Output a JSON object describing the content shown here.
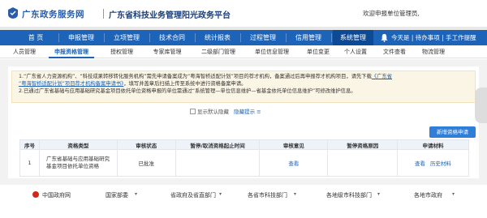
{
  "header": {
    "logo_text": "广东政务服务网",
    "system_title": "广东省科技业务管理阳光政务平台",
    "welcome": "欢迎申报单位管理员,"
  },
  "main_nav": {
    "items": [
      "首 页",
      "申报管理",
      "立项管理",
      "技术合同",
      "统计报表",
      "过程管理",
      "信用管理",
      "系统管理"
    ],
    "active_index": 7,
    "todo": "今天是 | 待办事项 | 手工作提醒"
  },
  "sub_nav": {
    "items": [
      "人员管理",
      "申报资格管理",
      "授权管理",
      "专家库管理",
      "二级部门管理",
      "单位信息管理",
      "单位变更",
      "个人设置",
      "文件查看",
      "物流管理"
    ],
    "active_index": 1
  },
  "notice": {
    "line1": "1.“广东省人力资源机构”、“科技成果转移转化服务机构”需先申请备案成为“粤海智桥适配计划”项目的荐才机构，备案通过后再申报荐才机构项目，请先下载",
    "line1_link": "《广东省",
    "line2_link": "“粤海智桥适配计划”项目荐才机构备案申请书》",
    "line2": "，填写并盖章后扫描上传至系统中进行资格备案申请。",
    "line3": "2.已通过广东省基础与应用基础研究基金项目依托单位资格申报的单位需通过“系统管理—单位信息维护—省基金依托单位信息维护”可修改维护信息。"
  },
  "toggle": {
    "checkbox_label": "显示默认隐藏",
    "hide_tip": "隐藏提示 ≡"
  },
  "add_button": "新增资格申请",
  "table": {
    "headers": [
      "序号",
      "资格类型",
      "审核状态",
      "暂停/取消资格起止时间",
      "审核意见",
      "暂停资格原因",
      "申请材料"
    ],
    "rows": [
      {
        "index": "1",
        "type_line1": "广东省基础与应用基础研究",
        "type_line2": "基金项目依托单位资格",
        "status": "已批准",
        "period": "",
        "opinion": "查看",
        "reason": "",
        "actions": [
          "查看",
          "历史材料"
        ]
      }
    ]
  },
  "footer": {
    "items": [
      "中国政府网",
      "国家部委",
      "省政府及省直部门",
      "各省市科技部门",
      "各地级市科技部门",
      "各地市政府"
    ]
  },
  "colors": {
    "primary": "#1d63b8",
    "primary_dark": "#0d4a96",
    "notice_bg": "#fbf5e6",
    "button": "#2f7ed8"
  }
}
